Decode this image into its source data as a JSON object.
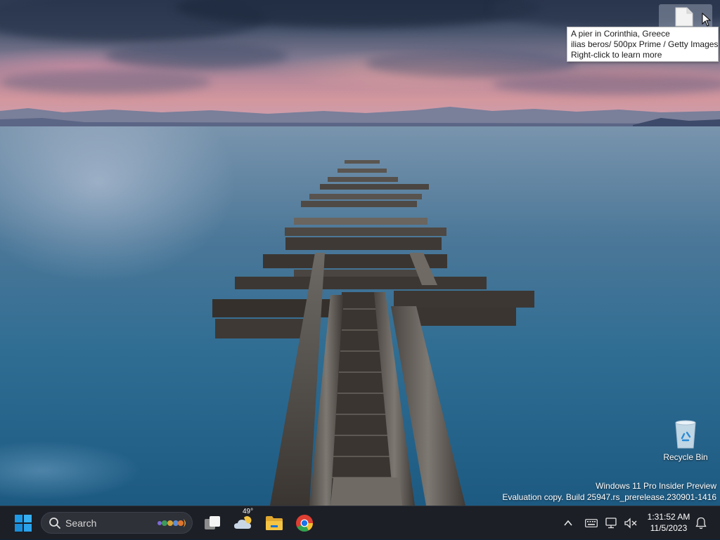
{
  "wallpaper": {
    "tooltip": {
      "line1": "A pier in Corinthia, Greece",
      "line2": "ilias beros/ 500px Prime / Getty Images",
      "line3": "Right-click to learn more"
    }
  },
  "desktop": {
    "icons": [
      {
        "label": "Recycle Bin",
        "icon": "recycle-bin-icon"
      }
    ],
    "watermark": {
      "line1": "Windows 11 Pro Insider Preview",
      "line2": "Evaluation copy. Build 25947.rs_prerelease.230901-1416"
    }
  },
  "taskbar": {
    "search_label": "Search",
    "weather_temp": "49°",
    "pinned": [
      "task-view-icon",
      "weather-icon",
      "file-explorer-icon",
      "chrome-icon"
    ],
    "tray": {
      "time": "1:31:52 AM",
      "date": "11/5/2023"
    }
  },
  "colors": {
    "taskbar": "#1c1f26",
    "start_blue": "#1f9ae6",
    "folder_yellow": "#f5c443"
  }
}
